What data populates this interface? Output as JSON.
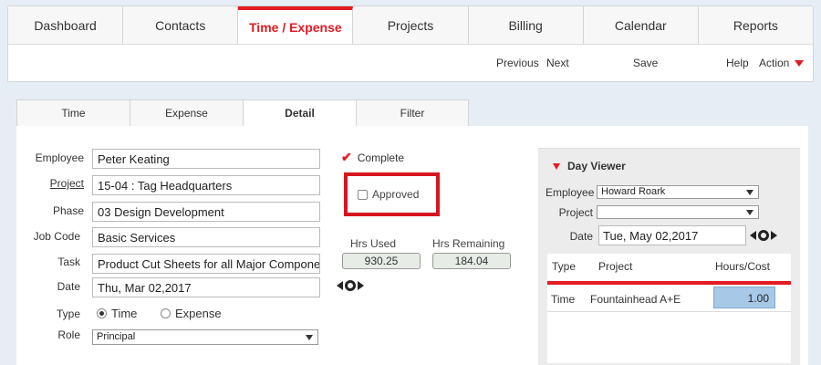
{
  "topnav": {
    "tabs": [
      "Dashboard",
      "Contacts",
      "Time / Expense",
      "Projects",
      "Billing",
      "Calendar",
      "Reports"
    ],
    "active": "Time / Expense"
  },
  "toolbar": {
    "previous": "Previous",
    "next": "Next",
    "save": "Save",
    "help": "Help",
    "action": "Action"
  },
  "subtabs": {
    "items": [
      "Time",
      "Expense",
      "Detail",
      "Filter"
    ],
    "active": "Detail"
  },
  "form": {
    "employee_label": "Employee",
    "employee_value": "Peter Keating",
    "project_label": "Project",
    "project_value": "15-04 : Tag Headquarters",
    "phase_label": "Phase",
    "phase_value": "03 Design Development",
    "jobcode_label": "Job Code",
    "jobcode_value": "Basic Services",
    "task_label": "Task",
    "task_value": "Product Cut Sheets for all Major Components",
    "date_label": "Date",
    "date_value": "Thu, Mar 02,2017",
    "type_label": "Type",
    "type_time": "Time",
    "type_expense": "Expense",
    "role_label": "Role",
    "role_value": "Principal"
  },
  "status": {
    "complete": "Complete",
    "approved": "Approved",
    "hrs_used_label": "Hrs Used",
    "hrs_used_value": "930.25",
    "hrs_remaining_label": "Hrs Remaining",
    "hrs_remaining_value": "184.04"
  },
  "dayviewer": {
    "title": "Day Viewer",
    "employee_label": "Employee",
    "employee_value": "Howard Roark",
    "project_label": "Project",
    "project_value": "",
    "date_label": "Date",
    "date_value": "Tue, May 02,2017",
    "columns": [
      "Type",
      "Project",
      "Hours/Cost"
    ],
    "rows": [
      {
        "type": "Time",
        "project": "Fountainhead A+E",
        "hours": "1.00"
      }
    ]
  },
  "colors": {
    "accent": "#e31b23",
    "highlight_box": "#d7151f",
    "value_cell": "#a8c8e8"
  }
}
